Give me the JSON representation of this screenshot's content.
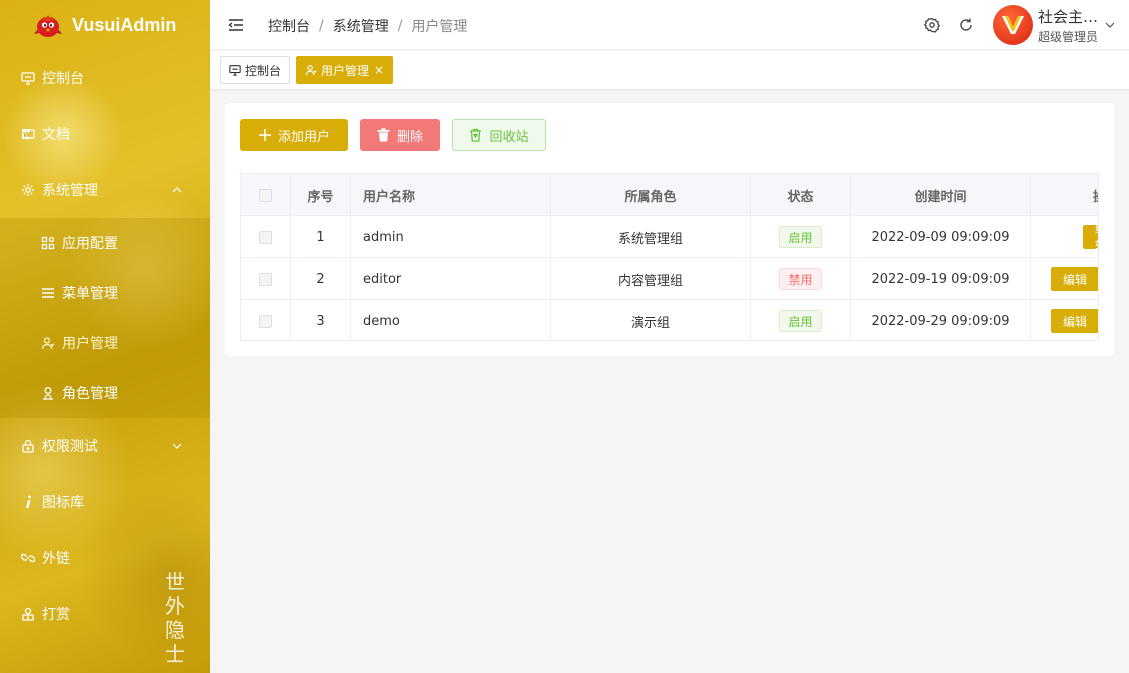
{
  "app": {
    "name": "VusuiAdmin"
  },
  "sidebar": {
    "items": [
      {
        "label": "控制台"
      },
      {
        "label": "文档"
      },
      {
        "label": "系统管理"
      },
      {
        "label": "权限测试"
      },
      {
        "label": "图标库"
      },
      {
        "label": "外链"
      },
      {
        "label": "打赏"
      }
    ],
    "system_children": [
      {
        "label": "应用配置"
      },
      {
        "label": "菜单管理"
      },
      {
        "label": "用户管理"
      },
      {
        "label": "角色管理"
      }
    ],
    "seal_text": "世外隐士"
  },
  "header": {
    "breadcrumb": [
      "控制台",
      "系统管理",
      "用户管理"
    ],
    "separator": "/",
    "user": {
      "name": "社会主…",
      "role": "超级管理员"
    }
  },
  "tabs": [
    {
      "label": "控制台"
    },
    {
      "label": "用户管理",
      "close": "×"
    }
  ],
  "toolbar": {
    "add_label": "添加用户",
    "delete_label": "删除",
    "recycle_label": "回收站"
  },
  "table": {
    "columns": [
      "序号",
      "用户名称",
      "所属角色",
      "状态",
      "创建时间",
      "操"
    ],
    "rows": [
      {
        "index": "1",
        "name": "admin",
        "role": "系统管理组",
        "status": "启用",
        "created": "2022-09-09 09:09:09",
        "action": "编辑"
      },
      {
        "index": "2",
        "name": "editor",
        "role": "内容管理组",
        "status": "禁用",
        "created": "2022-09-19 09:09:09",
        "action": "编辑"
      },
      {
        "index": "3",
        "name": "demo",
        "role": "演示组",
        "status": "启用",
        "created": "2022-09-29 09:09:09",
        "action": "编辑"
      }
    ]
  },
  "colors": {
    "accent": "#d8ad07",
    "danger": "#f37878",
    "success": "#67c23a"
  }
}
